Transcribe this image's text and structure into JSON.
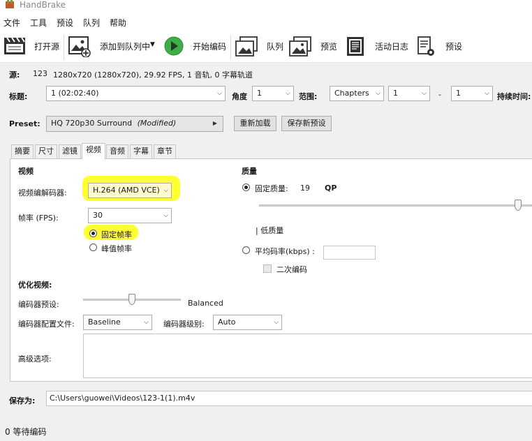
{
  "window": {
    "title": "HandBrake"
  },
  "menu": [
    "文件",
    "工具",
    "预设",
    "队列",
    "帮助"
  ],
  "toolbar": {
    "open_source": "打开源",
    "add_to_queue": "添加到队列中",
    "start_encode": "开始编码",
    "queue": "队列",
    "preview": "预览",
    "activity_log": "活动日志",
    "presets": "预设"
  },
  "source": {
    "label": "源:",
    "name": "123",
    "details": "1280x720 (1280x720), 29.92 FPS, 1 音轨, 0 字幕轨道"
  },
  "title_row": {
    "title_label": "标题:",
    "title_value": "1 (02:02:40)",
    "angle_label": "角度",
    "angle_value": "1",
    "range_label": "范围:",
    "range_type": "Chapters",
    "range_start": "1",
    "range_dash": "-",
    "range_end": "1",
    "duration_label": "持续时间:"
  },
  "preset_row": {
    "label": "Preset:",
    "name": "HQ 720p30 Surround",
    "modified": "(Modified)",
    "reload": "重新加载",
    "save_new": "保存新预设"
  },
  "tabs": [
    "摘要",
    "尺寸",
    "滤镜",
    "视频",
    "音频",
    "字幕",
    "章节"
  ],
  "video": {
    "section": "视频",
    "codec_label": "视频编解码器:",
    "codec_value": "H.264 (AMD VCE)",
    "fps_label": "帧率 (FPS):",
    "fps_value": "30",
    "constant_fps": "固定帧率",
    "peak_fps": "峰值帧率"
  },
  "quality": {
    "section": "质量",
    "constant_quality": "固定质量:",
    "cq_value": "19",
    "cq_unit": "QP",
    "low_quality": "| 低质量",
    "avg_bitrate": "平均码率(kbps) :",
    "bitrate_value": "",
    "two_pass": "二次编码",
    "slider_position": 0.975
  },
  "optimise": {
    "section": "优化视频:",
    "encoder_preset_label": "编码器预设:",
    "encoder_preset_value": "Balanced",
    "profile_label": "编码器配置文件:",
    "profile_value": "Baseline",
    "level_label": "编码器级别:",
    "level_value": "Auto",
    "advanced_label": "高级选项:",
    "preset_slider_position": 0.5
  },
  "save": {
    "label": "保存为:",
    "path": "C:\\Users\\guowei\\Videos\\123-1(1).m4v"
  },
  "status": {
    "text": "0 等待编码"
  },
  "colors": {
    "highlight": "#ffff33",
    "panel": "#f0f0f0",
    "play_green": "#3fae49"
  }
}
